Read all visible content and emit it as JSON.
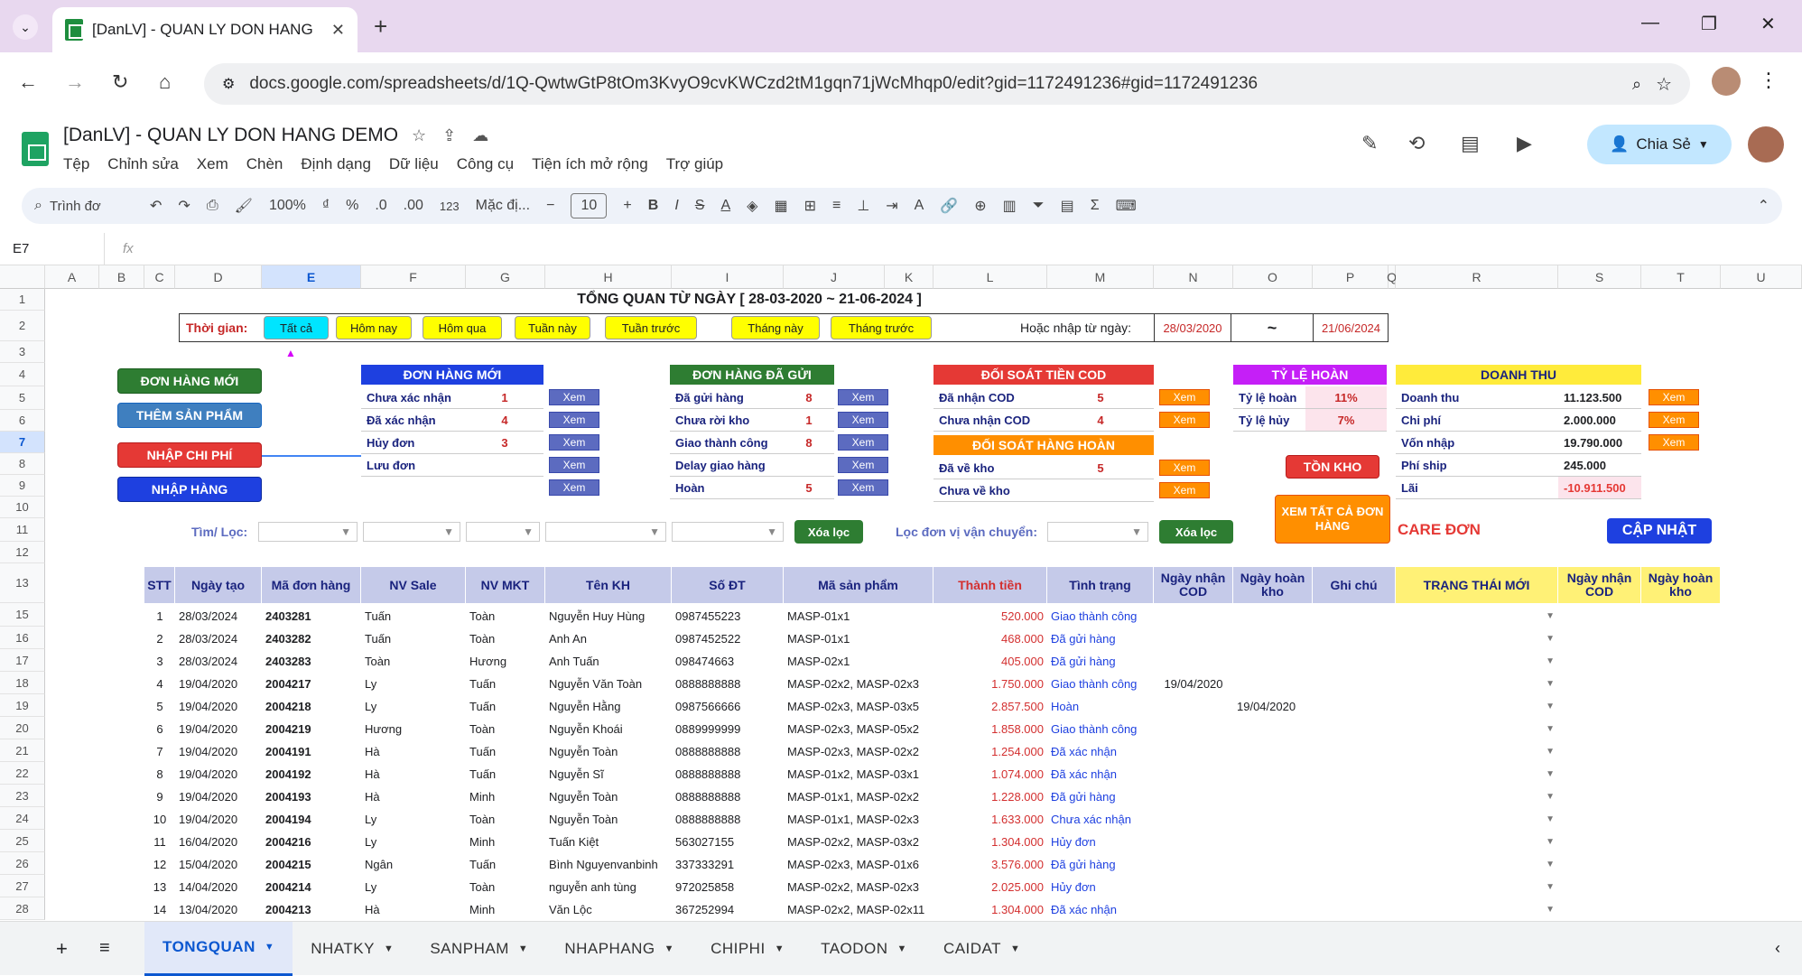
{
  "browser": {
    "tab_title": "[DanLV] - QUAN LY DON HANG",
    "url": "docs.google.com/spreadsheets/d/1Q-QwtwGtP8tOm3KvyO9cvKWCzd2tM1gqn71jWcMhqp0/edit?gid=1172491236#gid=1172491236"
  },
  "sheets": {
    "doc_title": "[DanLV] - QUAN LY DON HANG DEMO",
    "menu": [
      "Tệp",
      "Chỉnh sửa",
      "Xem",
      "Chèn",
      "Định dạng",
      "Dữ liệu",
      "Công cụ",
      "Tiện ích mở rộng",
      "Trợ giúp"
    ],
    "share_label": "Chia Sẻ",
    "search_label": "Trình đơ",
    "zoom": "100%",
    "font_name": "Mặc đị...",
    "font_size": "10",
    "name_box": "E7",
    "fx": "fx"
  },
  "columns": [
    "A",
    "B",
    "C",
    "D",
    "E",
    "F",
    "G",
    "H",
    "I",
    "J",
    "K",
    "L",
    "M",
    "N",
    "O",
    "P",
    "Q",
    "R",
    "S",
    "T",
    "U"
  ],
  "rows": [
    "1",
    "2",
    "3",
    "4",
    "5",
    "6",
    "7",
    "8",
    "9",
    "10",
    "11",
    "12",
    "13",
    "15",
    "16",
    "17",
    "18",
    "19",
    "20",
    "21",
    "22",
    "23",
    "24",
    "25",
    "26",
    "27",
    "28"
  ],
  "dashboard": {
    "title": "TỔNG QUAN TỪ NGÀY  [ 28-03-2020 ~ 21-06-2024 ]",
    "time_label": "Thời gian:",
    "time_buttons": [
      "Tất cả",
      "Hôm nay",
      "Hôm qua",
      "Tuần này",
      "Tuần trước",
      "Tháng này",
      "Tháng trước"
    ],
    "or_enter_label": "Hoặc nhập từ ngày:",
    "date_from": "28/03/2020",
    "date_sep": "~",
    "date_to": "21/06/2024",
    "left_buttons": [
      "ĐƠN HÀNG MỚI",
      "THÊM SẢN PHẨM",
      "NHẬP CHI PHÍ",
      "NHẬP HÀNG"
    ],
    "xem": "Xem",
    "new_orders": {
      "title": "ĐƠN HÀNG MỚI",
      "items": [
        {
          "label": "Chưa xác nhận",
          "value": "1"
        },
        {
          "label": "Đã xác nhận",
          "value": "4"
        },
        {
          "label": "Hủy đơn",
          "value": "3"
        },
        {
          "label": "Lưu đơn",
          "value": ""
        }
      ]
    },
    "sent_orders": {
      "title": "ĐƠN HÀNG ĐÃ GỬI",
      "items": [
        {
          "label": "Đã gửi hàng",
          "value": "8"
        },
        {
          "label": "Chưa rời kho",
          "value": "1"
        },
        {
          "label": "Giao thành công",
          "value": "8"
        },
        {
          "label": "Delay giao hàng",
          "value": ""
        },
        {
          "label": "Hoàn",
          "value": "5"
        }
      ]
    },
    "cod": {
      "title": "ĐỐI SOÁT TIỀN COD",
      "items": [
        {
          "label": "Đã nhận COD",
          "value": "5"
        },
        {
          "label": "Chưa nhận COD",
          "value": "4"
        }
      ]
    },
    "returns": {
      "title": "ĐỐI SOÁT HÀNG HOÀN",
      "items": [
        {
          "label": "Đã về kho",
          "value": "5"
        },
        {
          "label": "Chưa về kho",
          "value": ""
        }
      ]
    },
    "rate": {
      "title": "TỶ LỆ HOÀN",
      "items": [
        {
          "label": "Tỷ lệ hoàn",
          "value": "11%"
        },
        {
          "label": "Tỷ lệ hủy",
          "value": "7%"
        }
      ]
    },
    "revenue": {
      "title": "DOANH THU",
      "items": [
        {
          "label": "Doanh thu",
          "value": "11.123.500"
        },
        {
          "label": "Chi phí",
          "value": "2.000.000"
        },
        {
          "label": "Vốn nhập",
          "value": "19.790.000"
        },
        {
          "label": "Phí ship",
          "value": "245.000"
        },
        {
          "label": "Lãi",
          "value": "-10.911.500"
        }
      ]
    },
    "ton_kho": "TỒN KHO",
    "xem_tat_ca": "XEM TẤT CẢ ĐƠN HÀNG",
    "care_don": "CARE ĐƠN",
    "cap_nhat": "CẬP NHẬT",
    "filter_label": "Tìm/ Lọc:",
    "xoa_loc": "Xóa lọc",
    "filter_ship_label": "Lọc đơn vị vận chuyển:"
  },
  "table": {
    "headers": [
      "STT",
      "Ngày tạo",
      "Mã đơn hàng",
      "NV Sale",
      "NV MKT",
      "Tên KH",
      "Số ĐT",
      "Mã sản phẩm",
      "Thành tiền",
      "Tình trạng",
      "Ngày nhận COD",
      "Ngày hoàn kho",
      "Ghi chú",
      "TRẠNG THÁI MỚI",
      "Ngày nhận COD",
      "Ngày hoàn kho"
    ],
    "rows": [
      [
        "1",
        "28/03/2024",
        "2403281",
        "Tuấn",
        "Toàn",
        "Nguyễn Huy Hùng",
        "0987455223",
        "MASP-01x1",
        "520.000",
        "Giao thành công",
        "",
        ""
      ],
      [
        "2",
        "28/03/2024",
        "2403282",
        "Tuấn",
        "Toàn",
        "Anh An",
        "0987452522",
        "MASP-01x1",
        "468.000",
        "Đã gửi hàng",
        "",
        ""
      ],
      [
        "3",
        "28/03/2024",
        "2403283",
        "Toàn",
        "Hương",
        "Anh Tuấn",
        "098474663",
        "MASP-02x1",
        "405.000",
        "Đã gửi hàng",
        "",
        ""
      ],
      [
        "4",
        "19/04/2020",
        "2004217",
        "Ly",
        "Tuấn",
        "Nguyễn Văn Toàn",
        "0888888888",
        "MASP-02x2, MASP-02x3",
        "1.750.000",
        "Giao thành công",
        "19/04/2020",
        ""
      ],
      [
        "5",
        "19/04/2020",
        "2004218",
        "Ly",
        "Tuấn",
        "Nguyễn Hằng",
        "0987566666",
        "MASP-02x3, MASP-03x5",
        "2.857.500",
        "Hoàn",
        "",
        "19/04/2020"
      ],
      [
        "6",
        "19/04/2020",
        "2004219",
        "Hương",
        "Toàn",
        "Nguyễn Khoái",
        "0889999999",
        "MASP-02x3, MASP-05x2",
        "1.858.000",
        "Giao thành công",
        "",
        ""
      ],
      [
        "7",
        "19/04/2020",
        "2004191",
        "Hà",
        "Tuấn",
        "Nguyễn Toàn",
        "0888888888",
        "MASP-02x3, MASP-02x2",
        "1.254.000",
        "Đã xác nhận",
        "",
        ""
      ],
      [
        "8",
        "19/04/2020",
        "2004192",
        "Hà",
        "Tuấn",
        "Nguyễn Sĩ",
        "0888888888",
        "MASP-01x2, MASP-03x1",
        "1.074.000",
        "Đã xác nhận",
        "",
        ""
      ],
      [
        "9",
        "19/04/2020",
        "2004193",
        "Hà",
        "Minh",
        "Nguyễn Toàn",
        "0888888888",
        "MASP-01x1, MASP-02x2",
        "1.228.000",
        "Đã gửi hàng",
        "",
        ""
      ],
      [
        "10",
        "19/04/2020",
        "2004194",
        "Ly",
        "Toàn",
        "Nguyễn Toàn",
        "0888888888",
        "MASP-01x1, MASP-02x3",
        "1.633.000",
        "Chưa xác nhận",
        "",
        ""
      ],
      [
        "11",
        "16/04/2020",
        "2004216",
        "Ly",
        "Minh",
        "Tuấn Kiệt",
        "563027155",
        "MASP-02x2, MASP-03x2",
        "1.304.000",
        "Hủy đơn",
        "",
        ""
      ],
      [
        "12",
        "15/04/2020",
        "2004215",
        "Ngân",
        "Tuấn",
        "Bình Nguyenvanbinh",
        "337333291",
        "MASP-02x3, MASP-01x6",
        "3.576.000",
        "Đã gửi hàng",
        "",
        ""
      ],
      [
        "13",
        "14/04/2020",
        "2004214",
        "Ly",
        "Toàn",
        "nguyễn anh tùng",
        "972025858",
        "MASP-02x2, MASP-02x3",
        "2.025.000",
        "Hủy đơn",
        "",
        ""
      ],
      [
        "14",
        "13/04/2020",
        "2004213",
        "Hà",
        "Minh",
        "Văn Lộc",
        "367252994",
        "MASP-02x2, MASP-02x11",
        "1.304.000",
        "Đã xác nhận",
        "",
        ""
      ]
    ]
  },
  "sheet_tabs": [
    "TONGQUAN",
    "NHATKY",
    "SANPHAM",
    "NHAPHANG",
    "CHIPHI",
    "TAODON",
    "CAIDAT"
  ]
}
